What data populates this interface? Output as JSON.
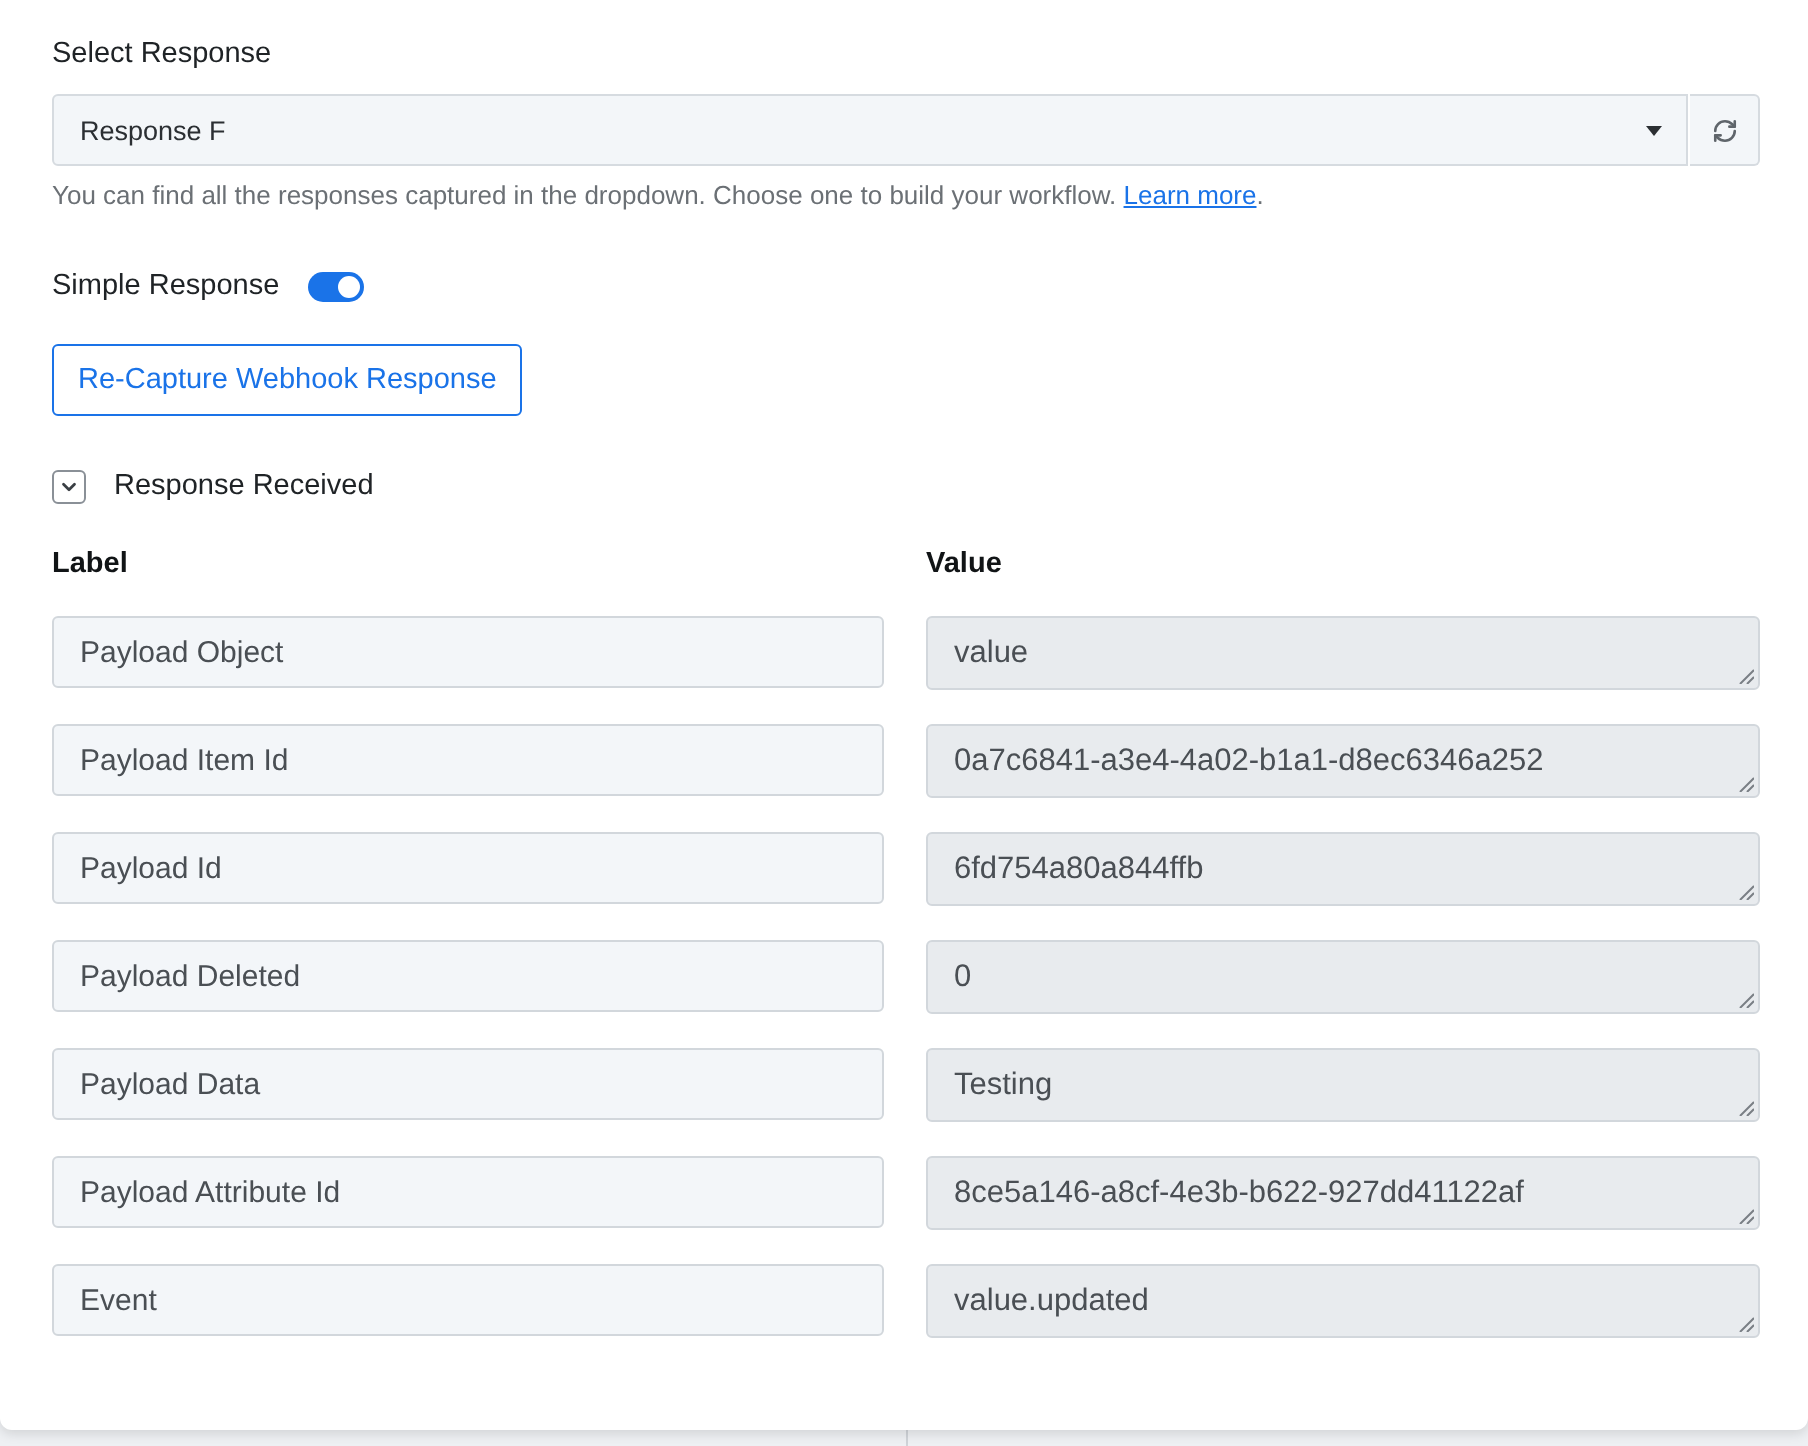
{
  "select_response": {
    "label": "Select Response",
    "value": "Response F",
    "help_text": "You can find all the responses captured in the dropdown. Choose one to build your workflow.",
    "help_link": "Learn more",
    "help_end": "."
  },
  "simple_response": {
    "label": "Simple Response",
    "on": true
  },
  "recapture_button": "Re-Capture Webhook Response",
  "response_received": {
    "title": "Response Received",
    "expanded": true,
    "columns": [
      "Label",
      "Value"
    ],
    "rows": [
      {
        "label": "Payload Object",
        "value": "value"
      },
      {
        "label": "Payload Item Id",
        "value": "0a7c6841-a3e4-4a02-b1a1-d8ec6346a252"
      },
      {
        "label": "Payload Id",
        "value": "6fd754a80a844ffb"
      },
      {
        "label": "Payload Deleted",
        "value": "0"
      },
      {
        "label": "Payload Data",
        "value": "Testing"
      },
      {
        "label": "Payload Attribute Id",
        "value": "8ce5a146-a8cf-4e3b-b622-927dd41122af"
      },
      {
        "label": "Event",
        "value": "value.updated"
      }
    ]
  }
}
